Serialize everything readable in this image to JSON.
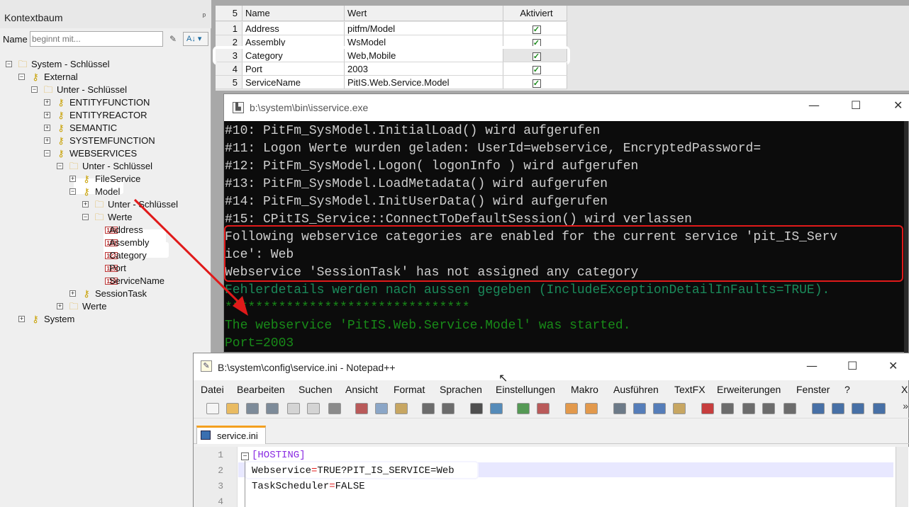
{
  "tree_panel": {
    "title": "Kontextbaum",
    "pin": "ᵖ",
    "name_label": "Name",
    "search_placeholder": "beginnt mit...",
    "nodes": [
      {
        "label": "System - Schlüssel",
        "expander": "⊟",
        "icon": "folder-icon"
      },
      {
        "label": "External",
        "expander": "⊟",
        "icon": "key-icon"
      },
      {
        "label": "Unter - Schlüssel",
        "expander": "⊟",
        "icon": "folder-icon"
      },
      {
        "label": "ENTITYFUNCTION",
        "expander": "⊞",
        "icon": "key-icon"
      },
      {
        "label": "ENTITYREACTOR",
        "expander": "⊞",
        "icon": "key-icon"
      },
      {
        "label": "SEMANTIC",
        "expander": "⊞",
        "icon": "key-icon"
      },
      {
        "label": "SYSTEMFUNCTION",
        "expander": "⊞",
        "icon": "key-icon"
      },
      {
        "label": "WEBSERVICES",
        "expander": "⊟",
        "icon": "key-icon"
      },
      {
        "label": "Unter - Schlüssel",
        "expander": "⊟",
        "icon": "folder-icon"
      },
      {
        "label": "FileService",
        "expander": "⊞",
        "icon": "key-icon"
      },
      {
        "label": "Model",
        "expander": "⊟",
        "icon": "key-icon"
      },
      {
        "label": "Unter - Schlüssel",
        "expander": "⊞",
        "icon": "folder-icon"
      },
      {
        "label": "Werte",
        "expander": "⊟",
        "icon": "folder-icon"
      },
      {
        "label": "Address",
        "icon": "value-icon"
      },
      {
        "label": "Assembly",
        "icon": "value-icon"
      },
      {
        "label": "Category",
        "icon": "value-icon"
      },
      {
        "label": "Port",
        "icon": "value-icon"
      },
      {
        "label": "ServiceName",
        "icon": "value-icon"
      },
      {
        "label": "SessionTask",
        "expander": "⊞",
        "icon": "key-icon"
      },
      {
        "label": "Werte",
        "expander": "⊞",
        "icon": "folder-icon"
      },
      {
        "label": "System",
        "expander": "⊞",
        "icon": "key-icon"
      }
    ]
  },
  "grid": {
    "headers": [
      "5",
      "Name",
      "Wert",
      "Aktiviert"
    ],
    "rows": [
      {
        "num": "1",
        "name": "Address",
        "value": "pitfm/Model",
        "activated": true
      },
      {
        "num": "2",
        "name": "Assembly",
        "value": "WsModel",
        "activated": true
      },
      {
        "num": "3",
        "name": "Category",
        "value": "Web,Mobile",
        "activated": true
      },
      {
        "num": "4",
        "name": "Port",
        "value": "2003",
        "activated": true
      },
      {
        "num": "5",
        "name": "ServiceName",
        "value": "PitIS.Web.Service.Model",
        "activated": true
      }
    ]
  },
  "console": {
    "title": "b:\\system\\bin\\isservice.exe",
    "lines": [
      {
        "text": "#10: PitFm_SysModel.InitialLoad() wird aufgerufen",
        "color": "#cfcfcf"
      },
      {
        "text": "#11: Logon Werte wurden geladen: UserId=webservice, EncryptedPassword=",
        "color": "#cfcfcf"
      },
      {
        "text": "#12: PitFm_SysModel.Logon( logonInfo ) wird aufgerufen",
        "color": "#cfcfcf"
      },
      {
        "text": "#13: PitFm_SysModel.LoadMetadata() wird aufgerufen",
        "color": "#cfcfcf"
      },
      {
        "text": "#14: PitFm_SysModel.InitUserData() wird aufgerufen",
        "color": "#cfcfcf"
      },
      {
        "text": "#15: CPitIS_Service::ConnectToDefaultSession() wird verlassen",
        "color": "#cfcfcf"
      },
      {
        "text": "Following webservice categories are enabled for the current service 'pit_IS_Serv",
        "color": "#cfcfcf"
      },
      {
        "text": "ice': Web",
        "color": "#cfcfcf"
      },
      {
        "text": "Webservice 'SessionTask' has not assigned any category",
        "color": "#cfcfcf"
      },
      {
        "text": "Fehlerdetails werden nach aussen gegeben (IncludeExceptionDetailInFaults=TRUE).",
        "color": "#1a8a5a"
      },
      {
        "text": "********************************",
        "color": "#188a18"
      },
      {
        "text": "The webservice 'PitIS.Web.Service.Model' was started.",
        "color": "#188a18"
      },
      {
        "text": "Port=2003",
        "color": "#188a18"
      }
    ]
  },
  "notepad": {
    "title": "B:\\system\\config\\service.ini - Notepad++",
    "menu": [
      "Datei",
      "Bearbeiten",
      "Suchen",
      "Ansicht",
      "Format",
      "Sprachen",
      "Einstellungen",
      "Makro",
      "Ausführen",
      "TextFX",
      "Erweiterungen",
      "Fenster",
      "?",
      "X"
    ],
    "tab": "service.ini",
    "overflow": "»",
    "lines": [
      {
        "num": "1",
        "parts": [
          {
            "t": "[HOSTING]",
            "c": "#8a2be2"
          }
        ]
      },
      {
        "num": "2",
        "parts": [
          {
            "t": "Webservice",
            "c": "#111111"
          },
          {
            "t": "=",
            "c": "#e01a1a"
          },
          {
            "t": "TRUE?PIT_IS_SERVICE=Web",
            "c": "#111111"
          }
        ]
      },
      {
        "num": "3",
        "parts": [
          {
            "t": "TaskScheduler",
            "c": "#111111"
          },
          {
            "t": "=",
            "c": "#e01a1a"
          },
          {
            "t": "FALSE",
            "c": "#111111"
          }
        ]
      },
      {
        "num": "4",
        "parts": []
      }
    ]
  },
  "window_controls": {
    "minimize": "—",
    "maximize": "☐",
    "close": "✕"
  },
  "colors": {
    "highlight_box": "#e01a1a",
    "arrow": "#e01a1a",
    "checkmark": "#1a8a1a"
  }
}
